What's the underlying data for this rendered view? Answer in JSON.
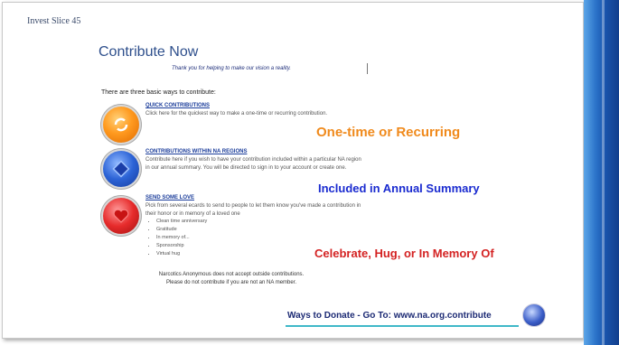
{
  "breadcrumb": "Invest   Slice 45",
  "title": "Contribute Now",
  "tagline": "Thank you for helping to make our vision a reality.",
  "intro": "There are three basic ways to contribute:",
  "sections": [
    {
      "link": "QUICK CONTRIBUTIONS",
      "desc": "Click here for the quickest way to make a one-time or recurring contribution."
    },
    {
      "link": "CONTRIBUTIONS WITHIN NA REGIONS",
      "desc": "Contribute here if you wish to have your contribution included within a particular NA region in our annual summary. You will be directed to sign in to your account or create one."
    },
    {
      "link": "SEND SOME LOVE",
      "desc": "Pick from several ecards to send to people to let them know you've made a contribution in their honor or in memory of a loved one"
    }
  ],
  "bullets": [
    "Clean time anniversary",
    "Gratitude",
    "In memory of...",
    "Sponsorship",
    "Virtual hug"
  ],
  "callouts": [
    "One-time or Recurring",
    "Included in Annual Summary",
    "Celebrate, Hug, or In Memory Of"
  ],
  "note": [
    "Narcotics Anonymous does not accept outside contributions.",
    "Please do not contribute if you are not an NA member."
  ],
  "donate": "Ways to Donate - Go To: www.na.org.contribute",
  "icons": [
    "refresh-icon",
    "diamond-icon",
    "heart-icon",
    "na-logo-icon"
  ],
  "colors": {
    "title": "#2e4f8c",
    "orange": "#f08a1c",
    "blue": "#1a2bd0",
    "red": "#d42222",
    "sidebar": "#1a55ad"
  }
}
